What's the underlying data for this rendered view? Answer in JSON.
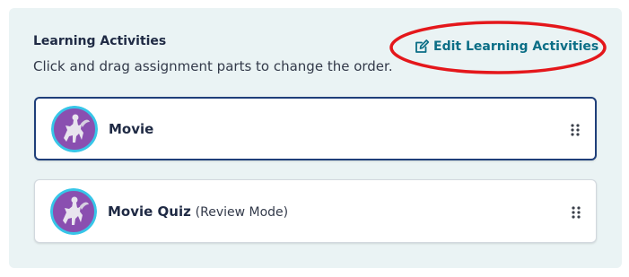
{
  "section": {
    "title": "Learning Activities",
    "instructions": "Click and drag assignment parts to change the order.",
    "edit_link_label": "Edit Learning Activities"
  },
  "activities": [
    {
      "name": "Movie",
      "mode": "",
      "icon": "pegasus-rider-icon",
      "selected": true
    },
    {
      "name": "Movie Quiz",
      "mode": "(Review Mode)",
      "icon": "pegasus-rider-icon",
      "selected": false
    }
  ],
  "colors": {
    "panel_bg": "#eaf3f4",
    "link": "#0b6e86",
    "heading_text": "#1f2a44",
    "selected_border": "#1f3f7a",
    "avatar_bg": "#8a4fb0",
    "avatar_ring": "#37c6e8",
    "annotation": "#e4171b"
  }
}
